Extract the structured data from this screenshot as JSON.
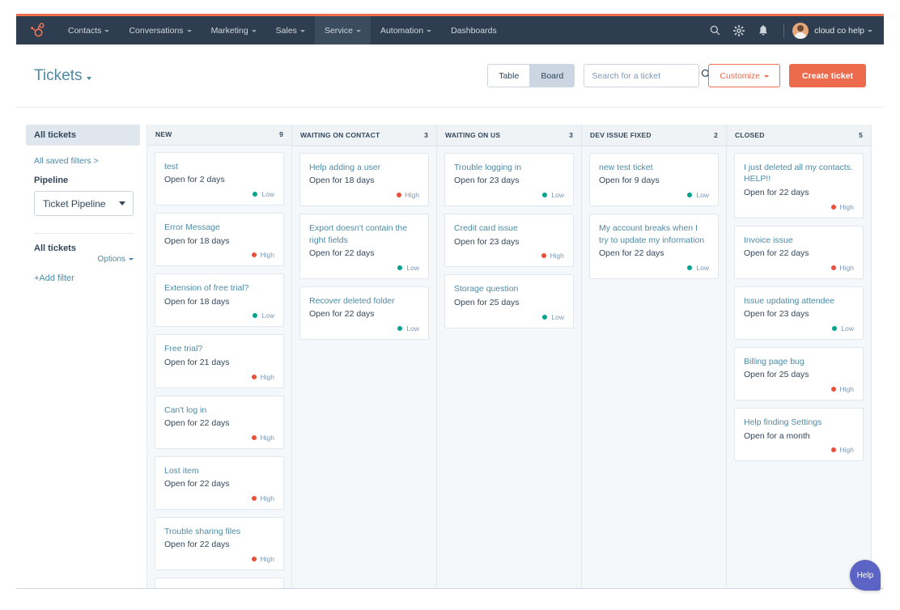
{
  "nav": {
    "logo_icon": "hubspot-sprocket-icon",
    "items": [
      {
        "label": "Contacts",
        "has_caret": true,
        "active": false
      },
      {
        "label": "Conversations",
        "has_caret": true,
        "active": false
      },
      {
        "label": "Marketing",
        "has_caret": true,
        "active": false
      },
      {
        "label": "Sales",
        "has_caret": true,
        "active": false
      },
      {
        "label": "Service",
        "has_caret": true,
        "active": true
      },
      {
        "label": "Automation",
        "has_caret": true,
        "active": false
      },
      {
        "label": "Dashboards",
        "has_caret": false,
        "active": false
      }
    ],
    "search_icon": "search-icon",
    "settings_icon": "gear-icon",
    "notifications_icon": "bell-icon",
    "account": "cloud co help",
    "accent_color": "#f2704e",
    "bar_color": "#2e3e50"
  },
  "header": {
    "title": "Tickets",
    "view_toggle": {
      "options": [
        "Table",
        "Board"
      ],
      "selected": "Board"
    },
    "search": {
      "placeholder": "Search for a ticket",
      "value": "",
      "icon": "search-icon"
    },
    "customize_label": "Customize",
    "create_label": "Create ticket"
  },
  "sidebar": {
    "all_tickets_pill": "All tickets",
    "saved_filters_link": "All saved filters >",
    "pipeline_label": "Pipeline",
    "pipeline_value": "Ticket Pipeline",
    "filter_group_label": "All tickets",
    "options_label": "Options",
    "add_filter_label": "+Add filter"
  },
  "board": {
    "columns": [
      {
        "name": "NEW",
        "count": "9",
        "cards": [
          {
            "title": "test",
            "age": "Open for 2 days",
            "priority": "Low",
            "priority_level": "low"
          },
          {
            "title": "Error Message",
            "age": "Open for 18 days",
            "priority": "High",
            "priority_level": "high"
          },
          {
            "title": "Extension of free trial?",
            "age": "Open for 18 days",
            "priority": "Low",
            "priority_level": "low"
          },
          {
            "title": "Free trial?",
            "age": "Open for 21 days",
            "priority": "High",
            "priority_level": "high"
          },
          {
            "title": "Can't log in",
            "age": "Open for 22 days",
            "priority": "High",
            "priority_level": "high"
          },
          {
            "title": "Lost item",
            "age": "Open for 22 days",
            "priority": "High",
            "priority_level": "high"
          },
          {
            "title": "Trouble sharing files",
            "age": "Open for 22 days",
            "priority": "High",
            "priority_level": "high"
          }
        ]
      },
      {
        "name": "WAITING ON CONTACT",
        "count": "3",
        "cards": [
          {
            "title": "Help adding a user",
            "age": "Open for 18 days",
            "priority": "High",
            "priority_level": "high"
          },
          {
            "title": "Export doesn't contain the right fields",
            "age": "Open for 22 days",
            "priority": "Low",
            "priority_level": "low"
          },
          {
            "title": "Recover deleted folder",
            "age": "Open for 22 days",
            "priority": "Low",
            "priority_level": "low"
          }
        ]
      },
      {
        "name": "WAITING ON US",
        "count": "3",
        "cards": [
          {
            "title": "Trouble logging in",
            "age": "Open for 23 days",
            "priority": "Low",
            "priority_level": "low"
          },
          {
            "title": "Credit card issue",
            "age": "Open for 23 days",
            "priority": "High",
            "priority_level": "high"
          },
          {
            "title": "Storage question",
            "age": "Open for 25 days",
            "priority": "Low",
            "priority_level": "low"
          }
        ]
      },
      {
        "name": "DEV ISSUE FIXED",
        "count": "2",
        "cards": [
          {
            "title": "new test ticket",
            "age": "Open for 9 days",
            "priority": "Low",
            "priority_level": "low"
          },
          {
            "title": "My account breaks when I try to update my information",
            "age": "Open for 22 days",
            "priority": "Low",
            "priority_level": "low"
          }
        ]
      },
      {
        "name": "CLOSED",
        "count": "5",
        "cards": [
          {
            "title": "I just deleted all my contacts. HELP!!",
            "age": "Open for 22 days",
            "priority": "High",
            "priority_level": "high"
          },
          {
            "title": "Invoice issue",
            "age": "Open for 22 days",
            "priority": "High",
            "priority_level": "high"
          },
          {
            "title": "Issue updating attendee",
            "age": "Open for 23 days",
            "priority": "Low",
            "priority_level": "low"
          },
          {
            "title": "Billing page bug",
            "age": "Open for 25 days",
            "priority": "High",
            "priority_level": "high"
          },
          {
            "title": "Help finding Settings",
            "age": "Open for a month",
            "priority": "High",
            "priority_level": "high"
          }
        ]
      }
    ]
  },
  "help": {
    "label": "Help"
  },
  "colors": {
    "priority_low": "#00a38d",
    "priority_high": "#e8503a",
    "link": "#4d8ba5",
    "primary": "#ed6b4d",
    "help_bubble": "#5b63c4"
  }
}
